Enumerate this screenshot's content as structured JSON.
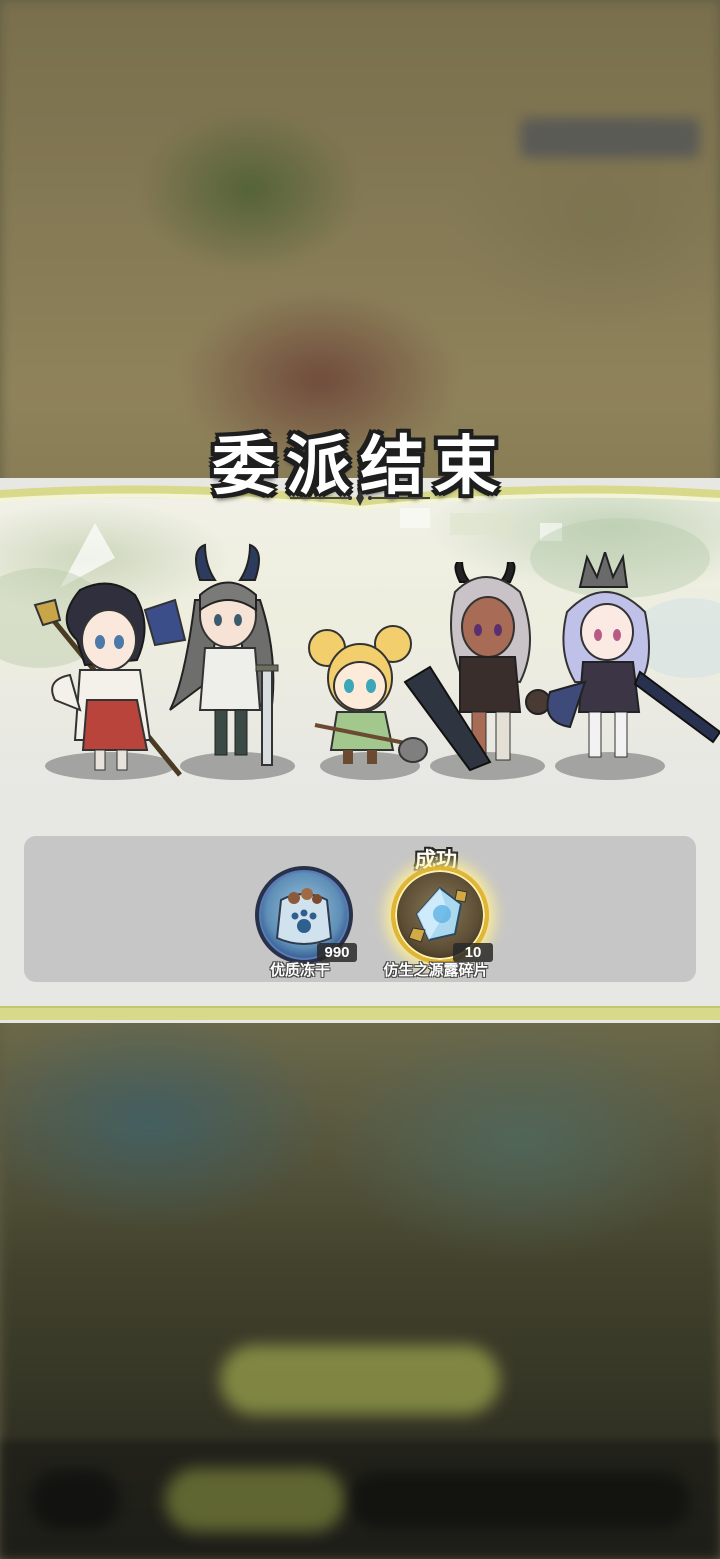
{
  "title": "委派结束",
  "heroes": [
    {
      "id": "priestess"
    },
    {
      "id": "horned-swordswoman"
    },
    {
      "id": "blonde-girl"
    },
    {
      "id": "dark-greatsword"
    },
    {
      "id": "crowned-knight"
    }
  ],
  "rewards": [
    {
      "name": "优质冻干",
      "quantity": "990",
      "icon": "paw-food-bag-icon",
      "ring_color": "#2e5a9e",
      "success": false
    },
    {
      "name": "仿生之源露碎片",
      "quantity": "10",
      "icon": "crystal-fragment-icon",
      "ring_color": "#e2b532",
      "success": true,
      "status_label": "成功"
    }
  ],
  "colors": {
    "accent_band": "#d8d98a",
    "panel_bg": "#e7e7e4",
    "reward_bg": "#c6c6c6"
  }
}
